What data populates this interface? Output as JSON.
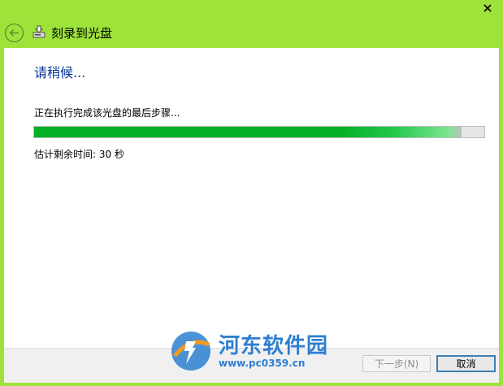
{
  "window": {
    "title": "刻录到光盘"
  },
  "content": {
    "heading": "请稍候...",
    "status_text": "正在执行完成该光盘的最后步骤...",
    "progress_percent": 95,
    "eta_text": "估计剩余时间: 30 秒"
  },
  "footer": {
    "next_label": "下一步(N)",
    "cancel_label": "取消"
  },
  "watermark": {
    "name": "河东软件园",
    "url": "www.pc0359.cn"
  },
  "icons": {
    "close": "close-icon",
    "back": "back-arrow-icon",
    "app": "disc-burner-icon",
    "logo": "hedong-logo-icon"
  },
  "colors": {
    "accent_bg": "#9de33a",
    "progress_green": "#06b025",
    "heading_blue": "#003399",
    "watermark_blue": "#2d7fd0"
  }
}
